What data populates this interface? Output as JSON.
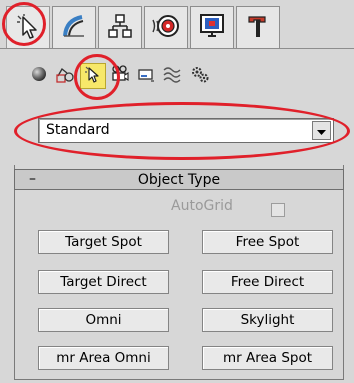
{
  "tabs": [
    {
      "name": "create-tab",
      "icon": "create-icon"
    },
    {
      "name": "modify-tab",
      "icon": "modify-icon"
    },
    {
      "name": "hierarchy-tab",
      "icon": "hierarchy-icon"
    },
    {
      "name": "motion-tab",
      "icon": "motion-icon"
    },
    {
      "name": "display-tab",
      "icon": "display-icon"
    },
    {
      "name": "utilities-tab",
      "icon": "hammer-icon"
    }
  ],
  "subtoolbar": [
    {
      "name": "geometry",
      "icon": "sphere-icon"
    },
    {
      "name": "shapes",
      "icon": "shapes-icon"
    },
    {
      "name": "lights",
      "icon": "light-icon"
    },
    {
      "name": "cameras",
      "icon": "camera-icon"
    },
    {
      "name": "helpers",
      "icon": "helper-icon"
    },
    {
      "name": "space-warps",
      "icon": "wave-icon"
    },
    {
      "name": "systems",
      "icon": "gears-icon"
    }
  ],
  "category_dropdown": {
    "value": "Standard"
  },
  "rollout": {
    "collapse_symbol": "–",
    "title": "Object Type",
    "autogrid_label": "AutoGrid"
  },
  "buttons": [
    "Target Spot",
    "Free Spot",
    "Target Direct",
    "Free Direct",
    "Omni",
    "Skylight",
    "mr Area Omni",
    "mr Area Spot"
  ],
  "colors": {
    "panel_bg": "#d7d7d7",
    "annotation_red": "#e0202a",
    "active_highlight": "#f7e86a"
  }
}
